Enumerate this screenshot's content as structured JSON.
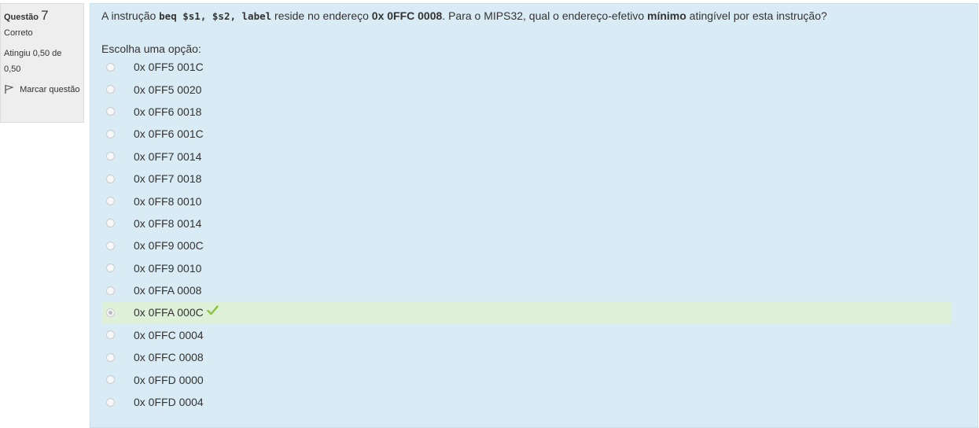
{
  "info": {
    "question_label": "Questão",
    "question_number": "7",
    "state": "Correto",
    "grade": "Atingiu 0,50 de 0,50",
    "flag_label": "Marcar questão"
  },
  "question": {
    "text_1": "A instrução ",
    "code": "beq $s1, $s2, label",
    "text_2": " reside no endereço ",
    "address": "0x 0FFC 0008",
    "text_3": ". Para o MIPS32, qual o endereço-efetivo ",
    "emphasis": "mínimo",
    "text_4": " atingível por esta instrução?",
    "prompt": "Escolha uma opção:"
  },
  "options": [
    {
      "label": "0x 0FF5 001C"
    },
    {
      "label": "0x 0FF5 0020"
    },
    {
      "label": "0x 0FF6 0018"
    },
    {
      "label": "0x 0FF6 001C"
    },
    {
      "label": "0x 0FF7 0014"
    },
    {
      "label": "0x 0FF7 0018"
    },
    {
      "label": "0x 0FF8 0010"
    },
    {
      "label": "0x 0FF8 0014"
    },
    {
      "label": "0x 0FF9 000C"
    },
    {
      "label": "0x 0FF9 0010"
    },
    {
      "label": "0x 0FFA 0008"
    },
    {
      "label": "0x 0FFA 000C"
    },
    {
      "label": "0x 0FFC 0004"
    },
    {
      "label": "0x 0FFC 0008"
    },
    {
      "label": "0x 0FFD 0000"
    },
    {
      "label": "0x 0FFD 0004"
    }
  ],
  "selected_option": 11,
  "colors": {
    "question_bg": "#d9ebf5",
    "info_bg": "#eeeeee",
    "correct_bg": "#dff0d8",
    "check": "#8ac43f"
  },
  "icons": {
    "flag": "flag-icon",
    "check": "check-icon"
  }
}
